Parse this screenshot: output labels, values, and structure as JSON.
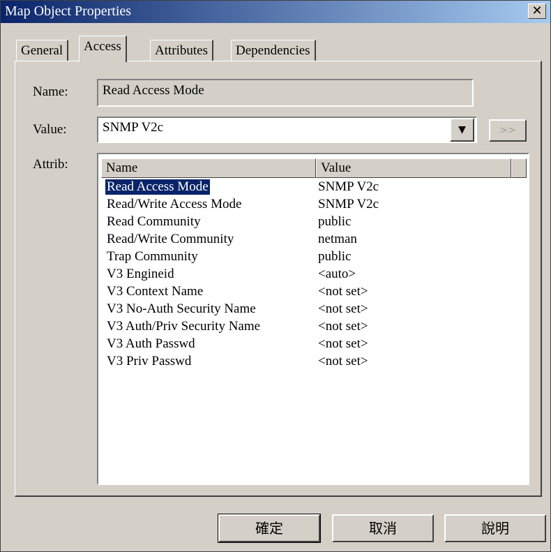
{
  "window": {
    "title": "Map Object Properties",
    "close_glyph": "✕"
  },
  "tabs": [
    "General",
    "Access",
    "Attributes",
    "Dependencies"
  ],
  "fields": {
    "name_label": "Name:",
    "name_value": "Read Access Mode",
    "value_label": "Value:",
    "value_value": "SNMP V2c",
    "more_button": ">>",
    "attrib_label": "Attrib:"
  },
  "list": {
    "columns": [
      "Name",
      "Value"
    ],
    "rows": [
      {
        "name": "Read Access Mode",
        "value": "SNMP V2c"
      },
      {
        "name": "Read/Write Access Mode",
        "value": "SNMP V2c"
      },
      {
        "name": "Read Community",
        "value": "public"
      },
      {
        "name": "Read/Write Community",
        "value": "netman"
      },
      {
        "name": "Trap Community",
        "value": "public"
      },
      {
        "name": "V3 Engineid",
        "value": "<auto>"
      },
      {
        "name": "V3 Context Name",
        "value": "<not set>"
      },
      {
        "name": "V3 No-Auth Security Name",
        "value": "<not set>"
      },
      {
        "name": "V3 Auth/Priv Security Name",
        "value": "<not set>"
      },
      {
        "name": "V3 Auth Passwd",
        "value": "<not set>"
      },
      {
        "name": "V3 Priv Passwd",
        "value": "<not set>"
      }
    ]
  },
  "buttons": {
    "ok": "確定",
    "cancel": "取消",
    "help": "說明"
  },
  "colors": {
    "titlebar_start": "#0a246a",
    "titlebar_end": "#a6caf0",
    "selection": "#0a246a",
    "face": "#d4d0c8"
  }
}
